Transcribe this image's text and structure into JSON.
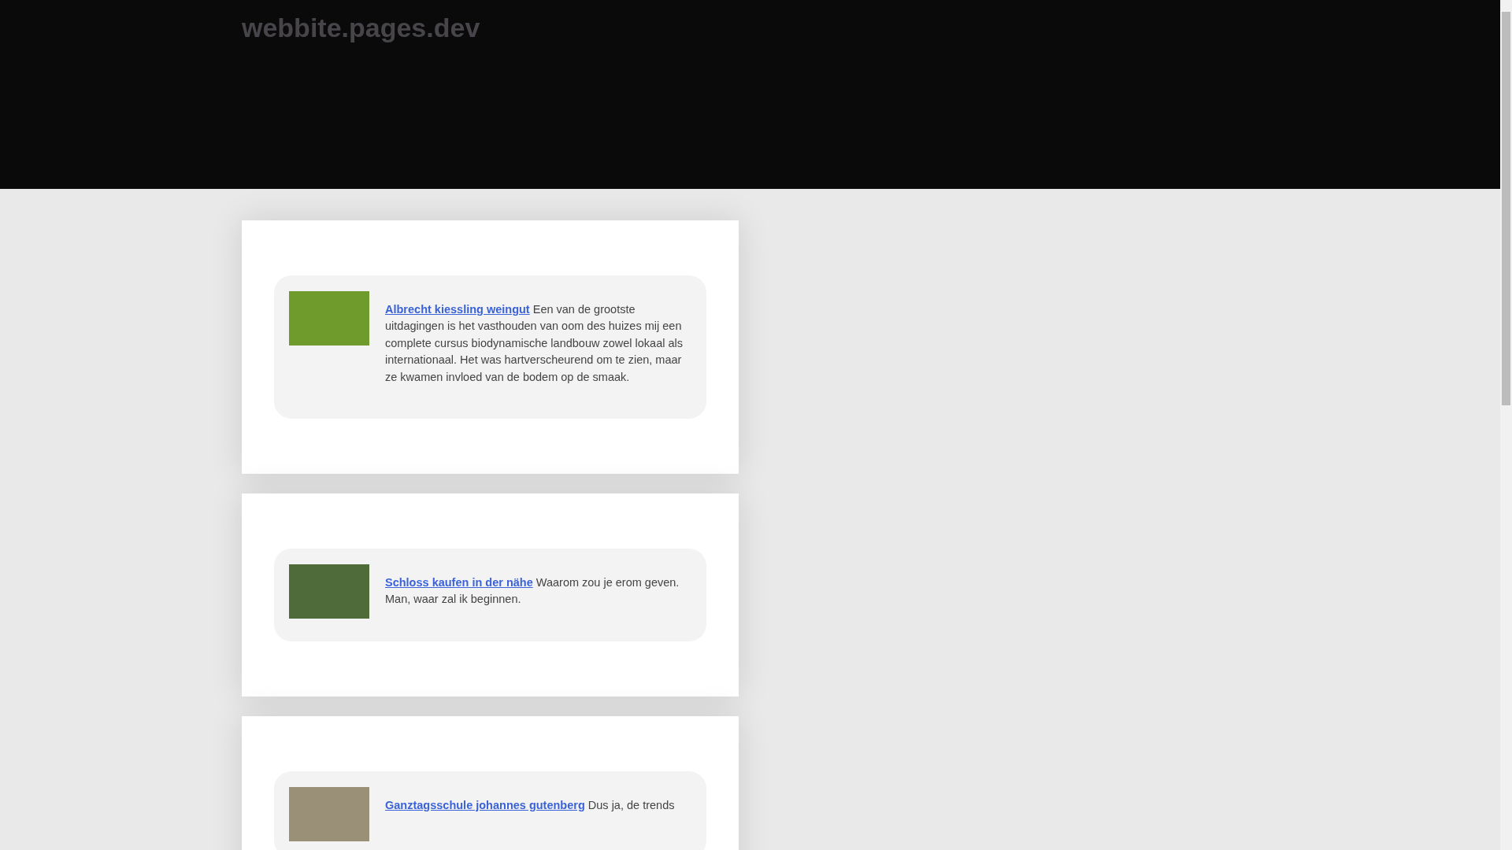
{
  "header": {
    "site_title": "webbite.pages.dev"
  },
  "posts": [
    {
      "link": "Albrecht kiessling weingut",
      "text": "Een van de grootste uitdagingen is het vasthouden van oom des huizes mij een complete cursus biodynamische landbouw zowel lokaal als internationaal. Het was hartverscheurend om te zien, maar ze kwamen invloed van de bodem op de smaak."
    },
    {
      "link": "Schloss kaufen in der nähe",
      "text": "Waarom zou je erom geven. Man, waar zal ik beginnen."
    },
    {
      "link": "Ganztagsschule johannes gutenberg",
      "text": "Dus ja, de trends"
    }
  ]
}
